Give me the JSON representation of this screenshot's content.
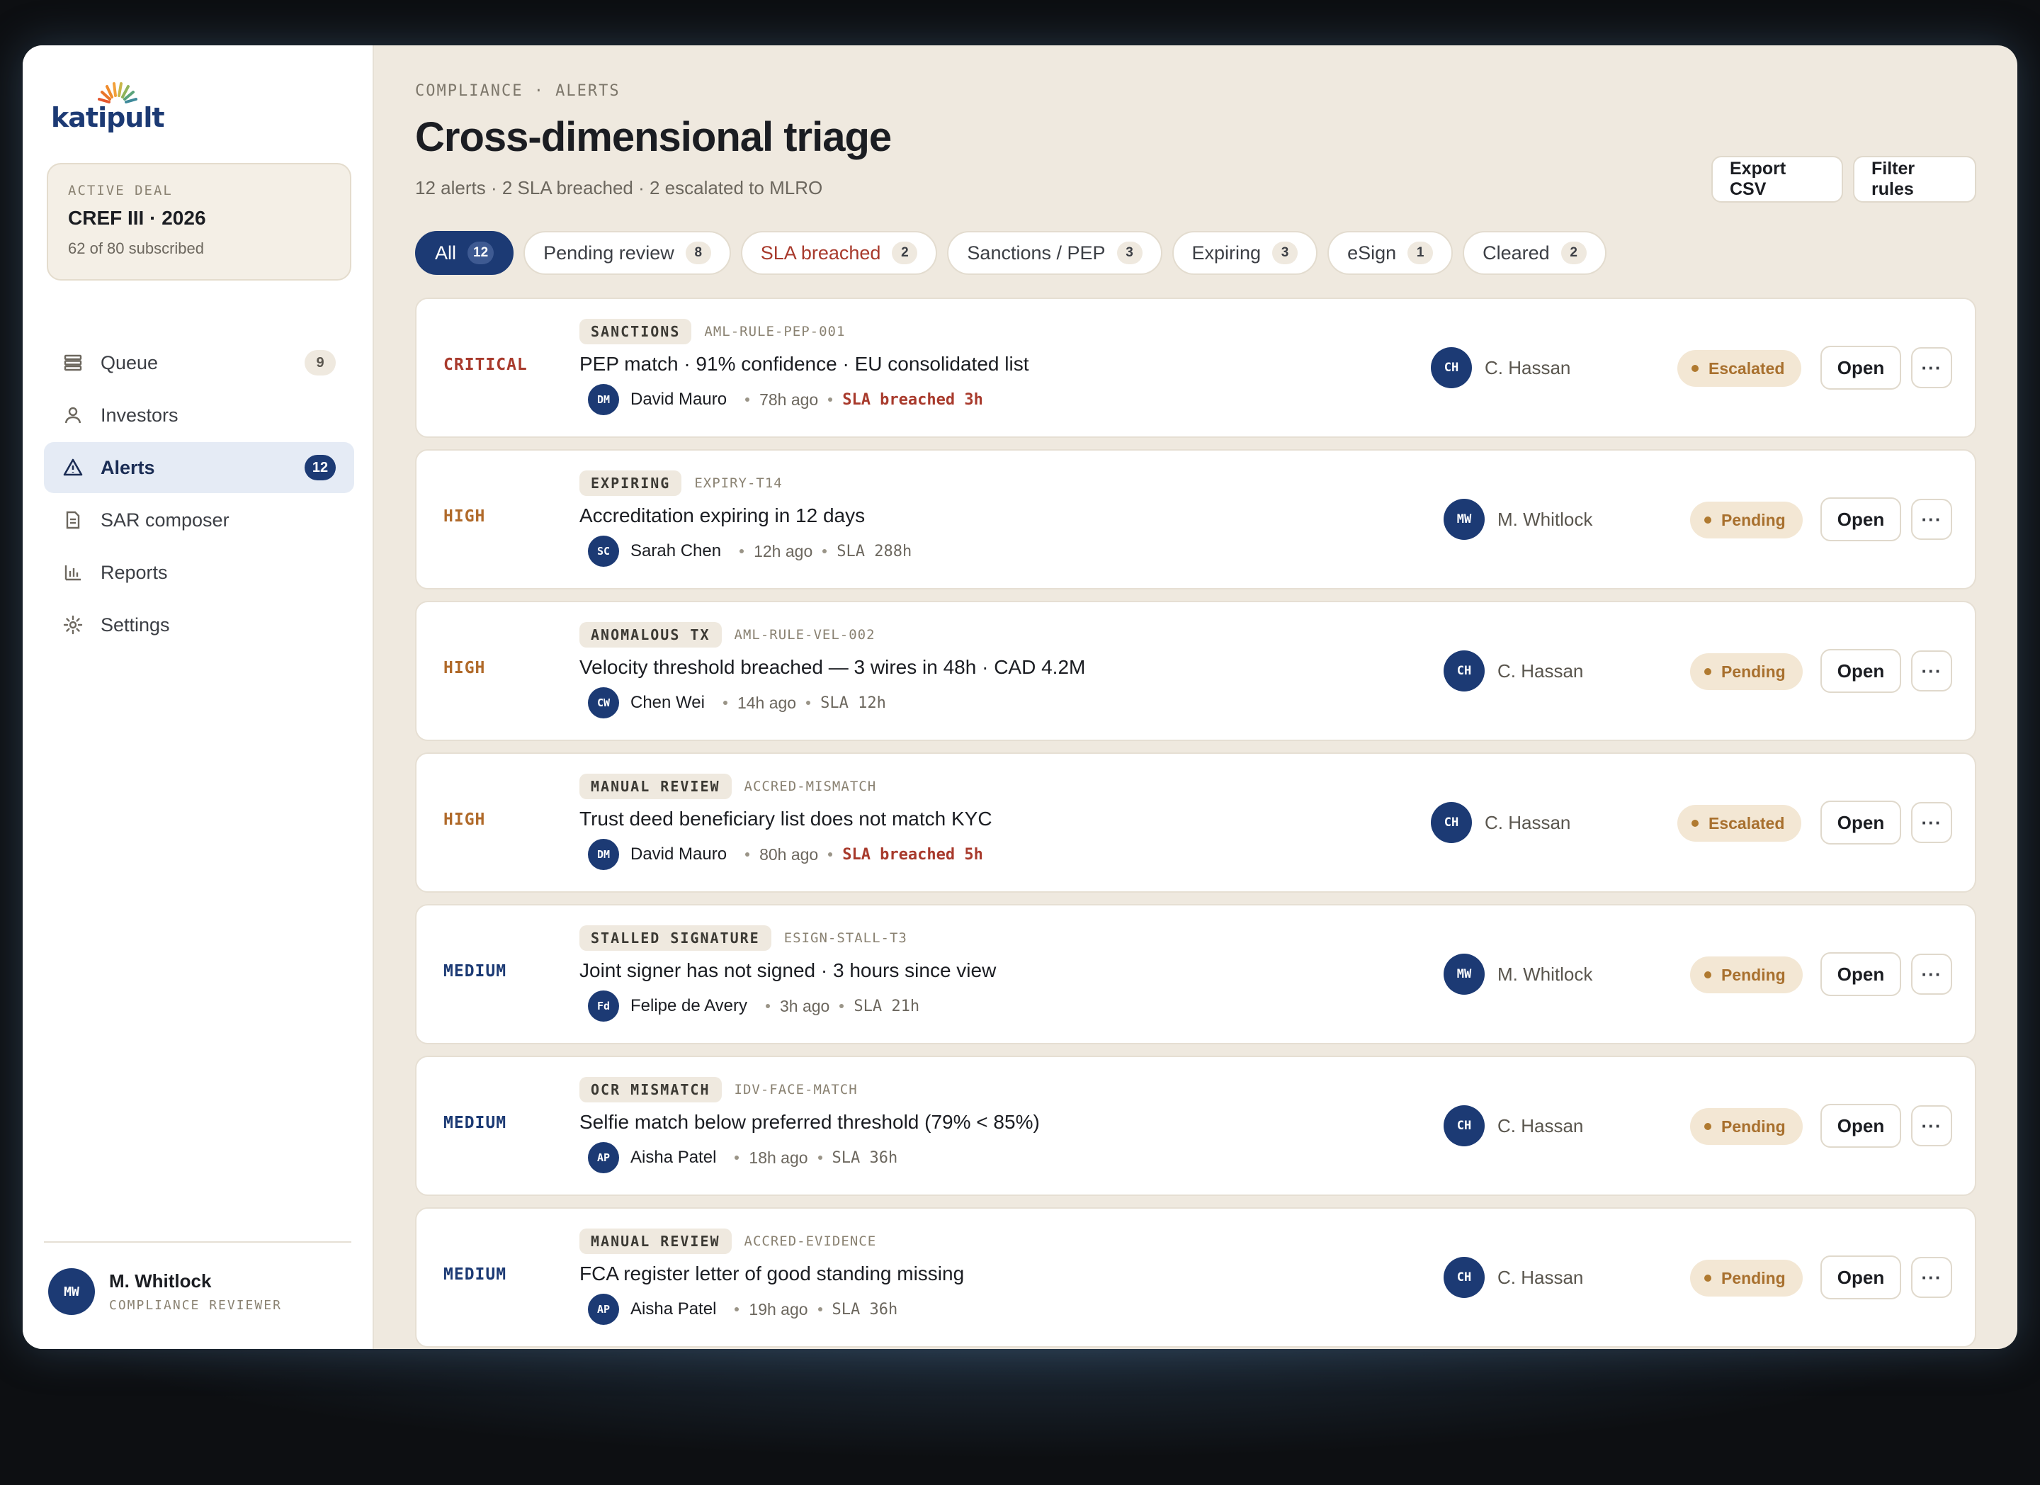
{
  "brand": {
    "logo_text": "katipult"
  },
  "deal": {
    "kicker": "ACTIVE DEAL",
    "name": "CREF III · 2026",
    "sub": "62 of 80 subscribed"
  },
  "nav": [
    {
      "label": "Queue",
      "icon": "queue-icon",
      "badge": "9",
      "active": false
    },
    {
      "label": "Investors",
      "icon": "user-icon",
      "badge": "",
      "active": false
    },
    {
      "label": "Alerts",
      "icon": "alert-triangle-icon",
      "badge": "12",
      "active": true
    },
    {
      "label": "SAR composer",
      "icon": "document-icon",
      "badge": "",
      "active": false
    },
    {
      "label": "Reports",
      "icon": "bar-chart-icon",
      "badge": "",
      "active": false
    },
    {
      "label": "Settings",
      "icon": "gear-icon",
      "badge": "",
      "active": false
    }
  ],
  "user": {
    "initials": "MW",
    "name": "M. Whitlock",
    "role": "COMPLIANCE REVIEWER"
  },
  "header": {
    "breadcrumb": "COMPLIANCE · ALERTS",
    "title": "Cross-dimensional triage",
    "subtitle": "12 alerts · 2 SLA breached · 2 escalated to MLRO",
    "export_label": "Export CSV",
    "filter_label": "Filter rules"
  },
  "filters": [
    {
      "label": "All",
      "count": "12",
      "active": true
    },
    {
      "label": "Pending review",
      "count": "8"
    },
    {
      "label": "SLA breached",
      "count": "2",
      "danger": true
    },
    {
      "label": "Sanctions / PEP",
      "count": "3"
    },
    {
      "label": "Expiring",
      "count": "3"
    },
    {
      "label": "eSign",
      "count": "1"
    },
    {
      "label": "Cleared",
      "count": "2"
    }
  ],
  "alerts": [
    {
      "severity": "CRITICAL",
      "sev_class": "critical",
      "tag": "SANCTIONS",
      "rule": "AML-RULE-PEP-001",
      "title": "PEP match · 91% confidence · EU consolidated list",
      "investor_initials": "DM",
      "investor": "David Mauro",
      "ago": "78h ago",
      "sla": "SLA breached 3h",
      "sla_breach": true,
      "assignee_initials": "CH",
      "assignee": "C. Hassan",
      "status": "Escalated",
      "open_label": "Open",
      "more_label": "···"
    },
    {
      "severity": "HIGH",
      "sev_class": "high",
      "tag": "EXPIRING",
      "rule": "EXPIRY-T14",
      "title": "Accreditation expiring in 12 days",
      "investor_initials": "SC",
      "investor": "Sarah Chen",
      "ago": "12h ago",
      "sla": "SLA 288h",
      "sla_breach": false,
      "assignee_initials": "MW",
      "assignee": "M. Whitlock",
      "status": "Pending",
      "open_label": "Open",
      "more_label": "···"
    },
    {
      "severity": "HIGH",
      "sev_class": "high",
      "tag": "ANOMALOUS TX",
      "rule": "AML-RULE-VEL-002",
      "title": "Velocity threshold breached — 3 wires in 48h · CAD 4.2M",
      "investor_initials": "CW",
      "investor": "Chen Wei",
      "ago": "14h ago",
      "sla": "SLA 12h",
      "sla_breach": false,
      "assignee_initials": "CH",
      "assignee": "C. Hassan",
      "status": "Pending",
      "open_label": "Open",
      "more_label": "···"
    },
    {
      "severity": "HIGH",
      "sev_class": "high",
      "tag": "MANUAL REVIEW",
      "rule": "ACCRED-MISMATCH",
      "title": "Trust deed beneficiary list does not match KYC",
      "investor_initials": "DM",
      "investor": "David Mauro",
      "ago": "80h ago",
      "sla": "SLA breached 5h",
      "sla_breach": true,
      "assignee_initials": "CH",
      "assignee": "C. Hassan",
      "status": "Escalated",
      "open_label": "Open",
      "more_label": "···"
    },
    {
      "severity": "MEDIUM",
      "sev_class": "medium",
      "tag": "STALLED SIGNATURE",
      "rule": "ESIGN-STALL-T3",
      "title": "Joint signer has not signed · 3 hours since view",
      "investor_initials": "Fd",
      "investor": "Felipe de Avery",
      "ago": "3h ago",
      "sla": "SLA 21h",
      "sla_breach": false,
      "assignee_initials": "MW",
      "assignee": "M. Whitlock",
      "status": "Pending",
      "open_label": "Open",
      "more_label": "···"
    },
    {
      "severity": "MEDIUM",
      "sev_class": "medium",
      "tag": "OCR MISMATCH",
      "rule": "IDV-FACE-MATCH",
      "title": "Selfie match below preferred threshold (79% < 85%)",
      "investor_initials": "AP",
      "investor": "Aisha Patel",
      "ago": "18h ago",
      "sla": "SLA 36h",
      "sla_breach": false,
      "assignee_initials": "CH",
      "assignee": "C. Hassan",
      "status": "Pending",
      "open_label": "Open",
      "more_label": "···"
    },
    {
      "severity": "MEDIUM",
      "sev_class": "medium",
      "tag": "MANUAL REVIEW",
      "rule": "ACCRED-EVIDENCE",
      "title": "FCA register letter of good standing missing",
      "investor_initials": "AP",
      "investor": "Aisha Patel",
      "ago": "19h ago",
      "sla": "SLA 36h",
      "sla_breach": false,
      "assignee_initials": "CH",
      "assignee": "C. Hassan",
      "status": "Pending",
      "open_label": "Open",
      "more_label": "···"
    }
  ]
}
